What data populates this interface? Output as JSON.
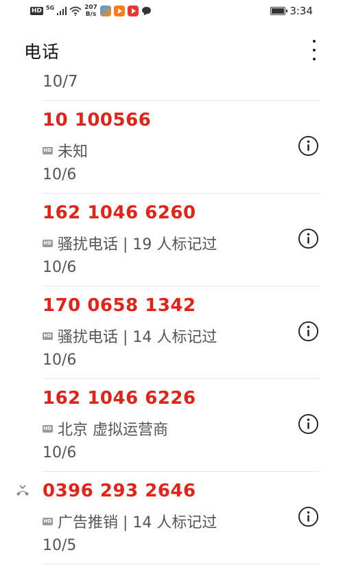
{
  "status_bar": {
    "hd_label": "HD",
    "network": "5G",
    "speed_value": "207",
    "speed_unit": "B/s",
    "time": "3:34"
  },
  "header": {
    "title": "电话"
  },
  "partial_entry": {
    "date": "10/7"
  },
  "calls": [
    {
      "number": "10 100566",
      "label": "未知",
      "date": "10/6",
      "missed": false
    },
    {
      "number": "162 1046 6260",
      "label": "骚扰电话 | 19 人标记过",
      "date": "10/6",
      "missed": false
    },
    {
      "number": "170 0658 1342",
      "label": "骚扰电话 | 14 人标记过",
      "date": "10/6",
      "missed": false
    },
    {
      "number": "162 1046 6226",
      "label": "北京 虚拟运营商",
      "date": "10/6",
      "missed": false
    },
    {
      "number": "0396 293 2646",
      "label": "广告推销 | 14 人标记过",
      "date": "10/5",
      "missed": true
    }
  ],
  "hd_tag": "HD",
  "colors": {
    "number_red": "#e2231a",
    "secondary_text": "#555555",
    "divider": "#e6e6e6"
  }
}
